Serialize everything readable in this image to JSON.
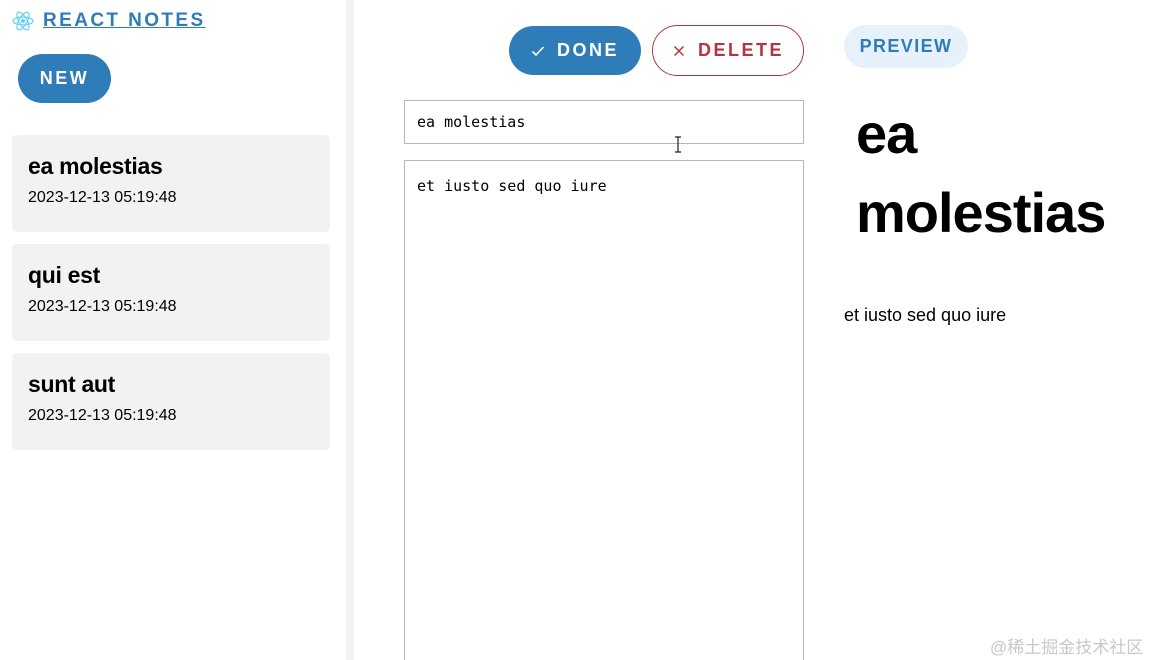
{
  "app": {
    "title": "REACT NOTES",
    "accent_color": "#2f7db8",
    "danger_color": "#b5343f"
  },
  "sidebar": {
    "new_label": "NEW",
    "notes": [
      {
        "title": "ea molestias",
        "date": "2023-12-13 05:19:48"
      },
      {
        "title": "qui est",
        "date": "2023-12-13 05:19:48"
      },
      {
        "title": "sunt aut",
        "date": "2023-12-13 05:19:48"
      }
    ]
  },
  "editor": {
    "done_label": "DONE",
    "delete_label": "DELETE",
    "title_value": "ea molestias",
    "body_value": "et iusto sed quo iure",
    "icons": {
      "done": "check-icon",
      "delete": "close-icon",
      "cursor": "text-cursor-icon"
    }
  },
  "preview": {
    "badge_label": "PREVIEW",
    "title": "ea molestias",
    "body": "et iusto sed quo iure"
  },
  "watermark": "@稀土掘金技术社区"
}
